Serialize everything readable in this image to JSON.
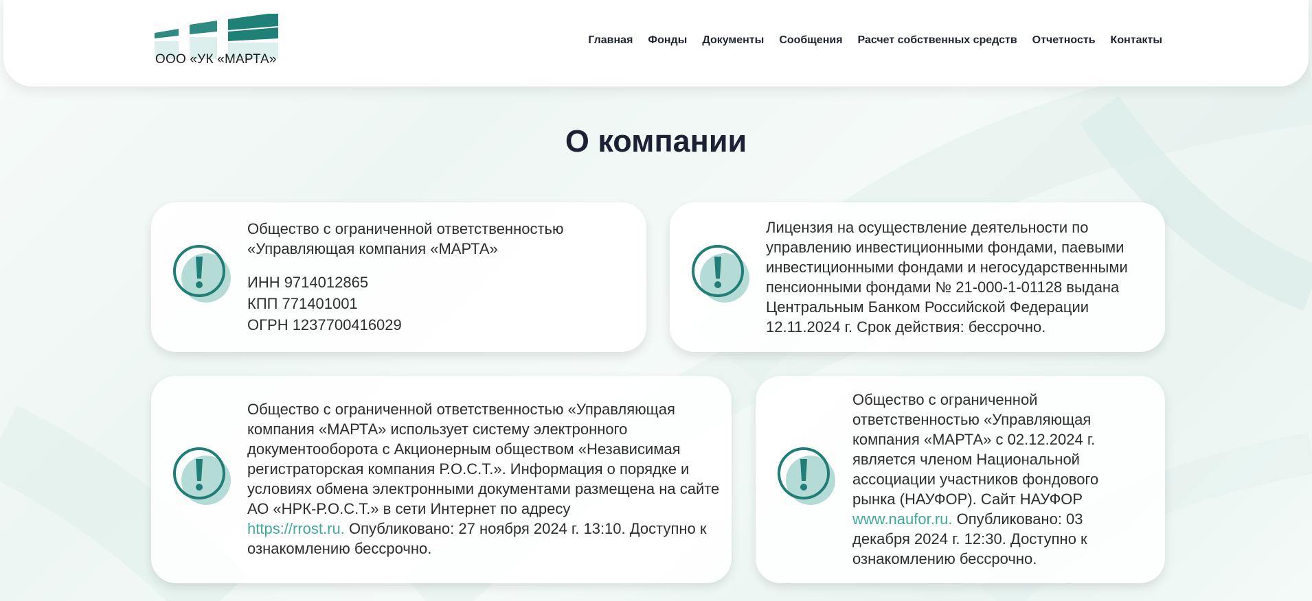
{
  "header": {
    "logo_text": "ООО «УК «МАРТА»",
    "nav": [
      "Главная",
      "Фонды",
      "Документы",
      "Сообщения",
      "Расчет собственных средств",
      "Отчетность",
      "Контакты"
    ]
  },
  "page_title": "О компании",
  "cards": {
    "company": {
      "name_line1": "Общество с ограниченной ответственностью",
      "name_line2": "«Управляющая компания «МАРТА»",
      "inn": "ИНН 9714012865",
      "kpp": "КПП 771401001",
      "ogrn": "ОГРН 1237700416029"
    },
    "license": {
      "text": "Лицензия на осуществление деятельности по управлению инвестиционными фондами, паевыми инвестиционными фондами и негосударственными пенсионными фондами № 21-000-1-01128 выдана Центральным Банком Российской Федерации 12.11.2024 г. Срок действия: бессрочно."
    },
    "edo": {
      "text_before": "Общество с ограниченной ответственностью «Управляющая компания «МАРТА» использует систему электронного документооборота с Акционерным обществом «Независимая регистраторская компания Р.О.С.Т.». Информация о порядке и условиях обмена электронными документами размещена на сайте АО «НРК-Р.О.С.Т.» в сети Интернет по адресу",
      "link": "https://rrost.ru.",
      "text_after": "Опубликовано: 27 ноября 2024 г. 13:10. Доступно к ознакомлению бессрочно."
    },
    "naufor": {
      "text_before": "Общество с ограниченной ответственностью «Управляющая компания «МАРТА» с 02.12.2024 г. является членом Национальной ассоциации участников фондового рынка (НАУФОР). Сайт НАУФОР",
      "link": "www.naufor.ru.",
      "text_after": "Опубликовано: 03 декабря 2024 г. 12:30. Доступно к ознакомлению бессрочно."
    }
  },
  "colors": {
    "accent": "#3fa99b",
    "icon_teal": "#217e76",
    "icon_fill": "#b5dbd6",
    "logo_teal": "#1f8077",
    "title": "#1c2233"
  },
  "icons": {
    "info": "exclamation-circle-icon"
  }
}
